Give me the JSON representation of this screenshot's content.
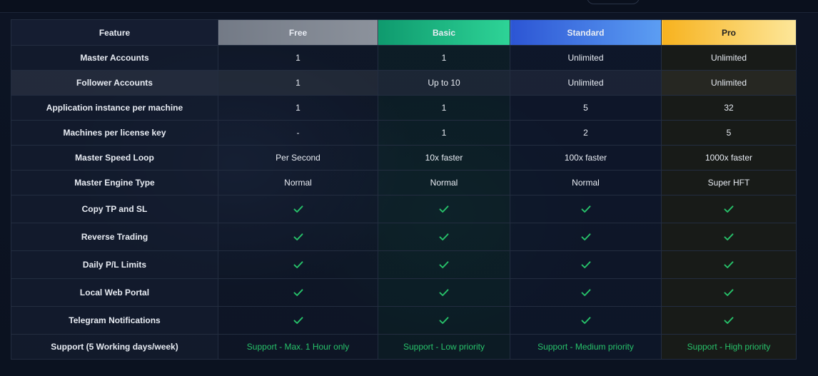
{
  "plans": [
    "Free",
    "Basic",
    "Standard",
    "Pro"
  ],
  "header": {
    "feature": "Feature",
    "free": "Free",
    "basic": "Basic",
    "standard": "Standard",
    "pro": "Pro"
  },
  "rows": [
    {
      "feature": "Master Accounts",
      "free": "1",
      "basic": "1",
      "standard": "Unlimited",
      "pro": "Unlimited"
    },
    {
      "feature": "Follower Accounts",
      "free": "1",
      "basic": "Up to 10",
      "standard": "Unlimited",
      "pro": "Unlimited"
    },
    {
      "feature": "Application instance per machine",
      "free": "1",
      "basic": "1",
      "standard": "5",
      "pro": "32"
    },
    {
      "feature": "Machines per license key",
      "free": "-",
      "basic": "1",
      "standard": "2",
      "pro": "5"
    },
    {
      "feature": "Master Speed Loop",
      "free": "Per Second",
      "basic": "10x faster",
      "standard": "100x faster",
      "pro": "1000x faster"
    },
    {
      "feature": "Master Engine Type",
      "free": "Normal",
      "basic": "Normal",
      "standard": "Normal",
      "pro": "Super HFT"
    },
    {
      "feature": "Copy TP and SL",
      "free": "check-icon",
      "basic": "check-icon",
      "standard": "check-icon",
      "pro": "check-icon"
    },
    {
      "feature": "Reverse Trading",
      "free": "check-icon",
      "basic": "check-icon",
      "standard": "check-icon",
      "pro": "check-icon"
    },
    {
      "feature": "Daily P/L Limits",
      "free": "check-icon",
      "basic": "check-icon",
      "standard": "check-icon",
      "pro": "check-icon"
    },
    {
      "feature": "Local Web Portal",
      "free": "check-icon",
      "basic": "check-icon",
      "standard": "check-icon",
      "pro": "check-icon"
    },
    {
      "feature": "Telegram Notifications",
      "free": "check-icon",
      "basic": "check-icon",
      "standard": "check-icon",
      "pro": "check-icon"
    },
    {
      "feature": "Support (5 Working days/week)",
      "free": "Support - Max. 1 Hour only",
      "basic": "Support - Low priority",
      "standard": "Support - Medium priority",
      "pro": "Support - High priority"
    }
  ],
  "colors": {
    "check": "#27c26a",
    "support_text": "#27c26a",
    "free_header": "#8c929c",
    "basic_header": "#2ed497",
    "standard_header": "#5c9ef3",
    "pro_header": "#fde79a"
  }
}
